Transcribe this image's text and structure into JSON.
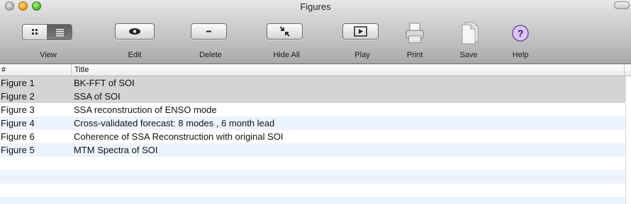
{
  "window": {
    "title": "Figures"
  },
  "toolbar": {
    "view_label": "View",
    "edit_label": "Edit",
    "delete_label": "Delete",
    "hide_all_label": "Hide All",
    "play_label": "Play",
    "print_label": "Print",
    "save_label": "Save",
    "help_label": "Help"
  },
  "table": {
    "columns": [
      "#",
      "Title"
    ],
    "rows": [
      {
        "num": "Figure 1",
        "title": "BK-FFT of SOI",
        "selected": true
      },
      {
        "num": "Figure 2",
        "title": "SSA of SOI",
        "selected": true
      },
      {
        "num": "Figure 3",
        "title": "SSA reconstruction of ENSO mode",
        "selected": false
      },
      {
        "num": "Figure 4",
        "title": "Cross-validated forecast: 8 modes , 6 month lead",
        "selected": false
      },
      {
        "num": "Figure 6",
        "title": "Coherence of SSA Reconstruction with original SOI",
        "selected": false
      },
      {
        "num": "Figure 5",
        "title": "MTM Spectra of SOI",
        "selected": false
      }
    ]
  },
  "colors": {
    "selected_row": "#d4d4d4",
    "alt_row": "#edf3fe"
  }
}
